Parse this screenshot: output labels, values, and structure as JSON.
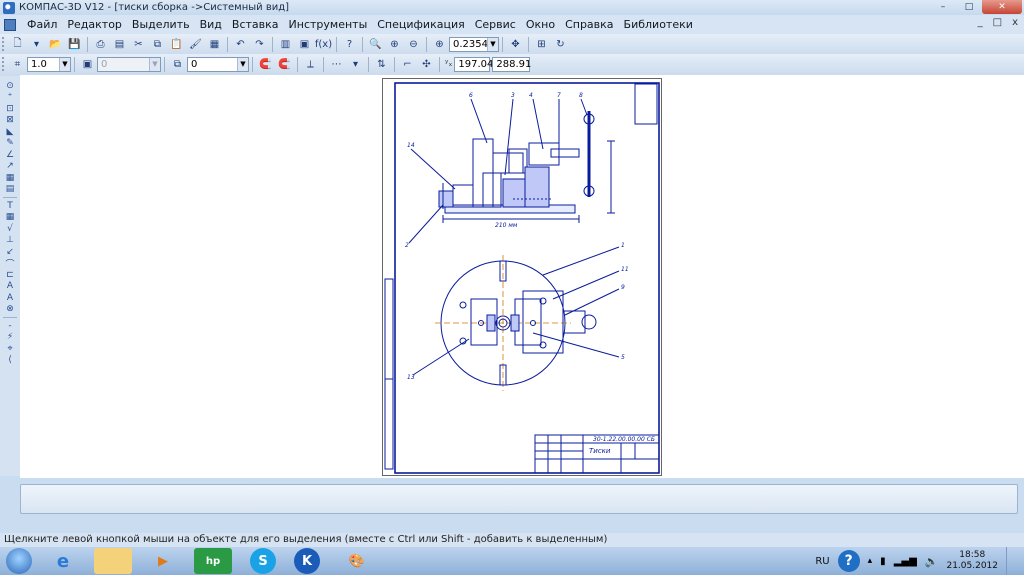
{
  "window": {
    "title": "КОМПАС-3D V12 - [тиски сборка ->Системный вид]",
    "controls": [
      "–",
      "□",
      "✕"
    ]
  },
  "menu": {
    "items": [
      "Файл",
      "Редактор",
      "Выделить",
      "Вид",
      "Вставка",
      "Инструменты",
      "Спецификация",
      "Сервис",
      "Окно",
      "Справка",
      "Библиотеки"
    ],
    "doc_controls": [
      "_",
      "□",
      "x"
    ]
  },
  "toolbar": {
    "zoom_value": "0.2354",
    "line_scale": "1.0",
    "layer_value": "0",
    "state_value": "0",
    "coord_x": "197.04",
    "coord_y": "288.91"
  },
  "drawing": {
    "designation": "30-1.22.00.00.00 СБ",
    "name": "Тиски",
    "dim_bottom": "210 мм"
  },
  "statusbar": {
    "text": "Щелкните левой кнопкой мыши на объекте для его выделения (вместе с Ctrl или Shift - добавить к выделенным)"
  },
  "taskbar": {
    "apps": [
      "explorer-ie",
      "file-explorer",
      "media-player",
      "hp-app",
      "skype",
      "kompas",
      "paint"
    ],
    "lang": "RU",
    "time": "18:58",
    "date": "21.05.2012"
  }
}
